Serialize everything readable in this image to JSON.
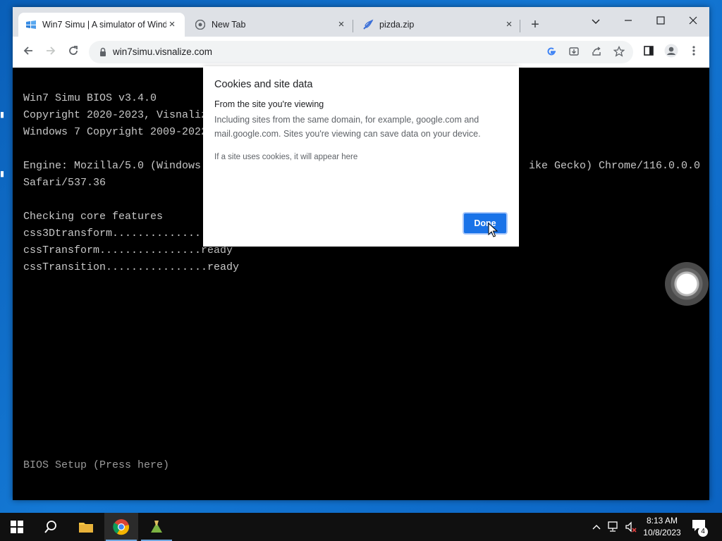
{
  "browser": {
    "tabs": [
      {
        "title": "Win7 Simu | A simulator of Windows 7",
        "favicon": "win7simu-icon",
        "active": true
      },
      {
        "title": "New Tab",
        "favicon": "chrome-icon",
        "active": false
      },
      {
        "title": "pizda.zip",
        "favicon": "zip-site-icon",
        "active": false
      }
    ],
    "tab_close": "×",
    "new_tab": "+",
    "url": "win7simu.visnalize.com"
  },
  "terminal": {
    "lines": [
      "Win7 Simu BIOS v3.4.0",
      "Copyright 2020-2023, Visnalize",
      "Windows 7 Copyright 2009-2022",
      "",
      "Engine: Mozilla/5.0 (Windows",
      "Safari/537.36",
      "",
      "Checking core features",
      "css3Dtransform..............",
      "cssTransform................ready",
      "cssTransition................ready"
    ],
    "engine_tail": "ike Gecko) Chrome/116.0.0.0",
    "bios_setup": "BIOS Setup (Press here)"
  },
  "popup": {
    "title": "Cookies and site data",
    "subtitle": "From the site you're viewing",
    "description": "Including sites from the same domain, for example, google.com and mail.google.com. Sites you're viewing can save data on your device.",
    "note": "If a site uses cookies, it will appear here",
    "done_label": "Done"
  },
  "taskbar": {
    "time": "8:13 AM",
    "date": "10/8/2023",
    "notification_count": "4"
  },
  "colors": {
    "accent": "#1a73e8",
    "desktop": "#0b63c2",
    "taskbar": "#101010"
  }
}
